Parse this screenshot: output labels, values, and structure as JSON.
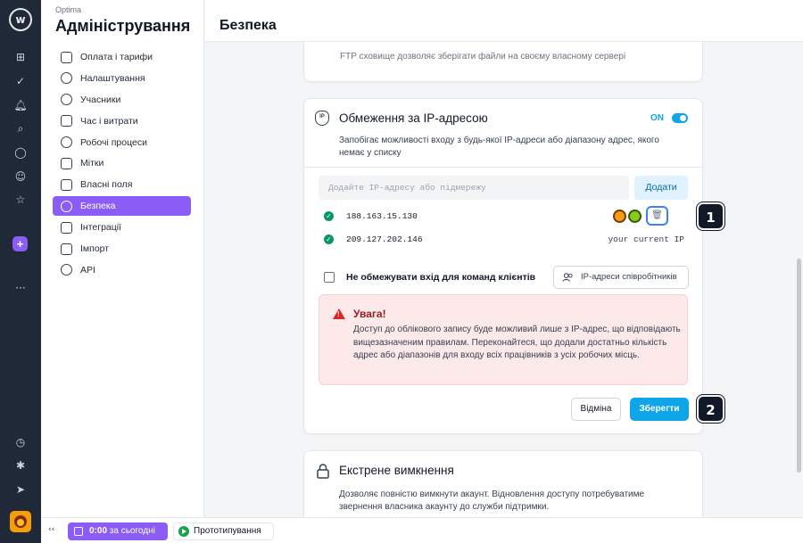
{
  "sidebar": {
    "org_name": "Optima",
    "title": "Адміністрування",
    "items": [
      {
        "label": "Оплата і тарифи"
      },
      {
        "label": "Налаштування"
      },
      {
        "label": "Учасники"
      },
      {
        "label": "Час і витрати"
      },
      {
        "label": "Робочі процеси"
      },
      {
        "label": "Мітки"
      },
      {
        "label": "Власні поля"
      },
      {
        "label": "Безпека"
      },
      {
        "label": "Інтеграції"
      },
      {
        "label": "Імпорт"
      },
      {
        "label": "API"
      }
    ]
  },
  "header": {
    "title": "Безпека"
  },
  "ftp_card": {
    "description": "FTP сховище дозволяє зберігати файли на своєму власному сервері"
  },
  "ip_card": {
    "icon_text": "IP",
    "title": "Обмеження за IP-адресою",
    "toggle_label": "ON",
    "description": "Запобігає можливості входу з будь-якої IP-адреси або діапазону адрес, якого немає у списку",
    "input_placeholder": "Додайте IP-адресу або підмережу",
    "add_label": "Додати",
    "ips": [
      {
        "address": "188.163.15.130",
        "note": ""
      },
      {
        "address": "209.127.202.146",
        "note": "your current IP"
      }
    ],
    "checkbox_label": "Не обмежувати вхід для команд клієнтів",
    "employees_label": "IP-адреси співробітників",
    "alert_title": "Увага!",
    "alert_text": "Доступ до облікового запису буде можливий лише з IP-адрес, що відповідають вищезазначеним правилам. Переконайтеся, що додали достатньо кількість адрес або діапазонів для входу всіх працівників з усіх робочих місць.",
    "cancel_label": "Відміна",
    "save_label": "Зберегти"
  },
  "emergency_card": {
    "title": "Екстрене вимкнення",
    "description": "Дозволяє повністю вимкнути акаунт. Відновлення доступу потребуватиме звернення власника акаунту до служби підтримки."
  },
  "markers": {
    "m1": "1",
    "m2": "2"
  },
  "bottom": {
    "collapse": "‹‹",
    "timer_value": "0:00",
    "timer_suffix": " за сьогодні",
    "project": "Прототипування"
  },
  "colors": {
    "accent": "#8b5cf6",
    "primary": "#0ea5e9",
    "danger": "#dc2626",
    "success": "#059669"
  }
}
